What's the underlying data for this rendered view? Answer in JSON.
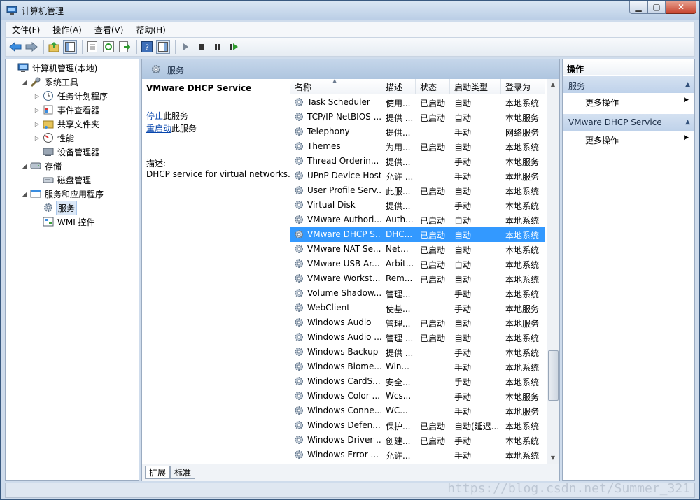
{
  "window": {
    "title": "计算机管理"
  },
  "menu": [
    "文件(F)",
    "操作(A)",
    "查看(V)",
    "帮助(H)"
  ],
  "tree": [
    {
      "label": "计算机管理(本地)",
      "indent": 0,
      "toggle": "",
      "icon": "computer-management-icon"
    },
    {
      "label": "系统工具",
      "indent": 1,
      "toggle": "◢",
      "icon": "tools-icon"
    },
    {
      "label": "任务计划程序",
      "indent": 2,
      "toggle": "▷",
      "icon": "clock-icon"
    },
    {
      "label": "事件查看器",
      "indent": 2,
      "toggle": "▷",
      "icon": "event-viewer-icon"
    },
    {
      "label": "共享文件夹",
      "indent": 2,
      "toggle": "▷",
      "icon": "shared-folder-icon"
    },
    {
      "label": "性能",
      "indent": 2,
      "toggle": "▷",
      "icon": "performance-icon"
    },
    {
      "label": "设备管理器",
      "indent": 2,
      "toggle": "",
      "icon": "device-manager-icon"
    },
    {
      "label": "存储",
      "indent": 1,
      "toggle": "◢",
      "icon": "storage-icon"
    },
    {
      "label": "磁盘管理",
      "indent": 2,
      "toggle": "",
      "icon": "disk-icon"
    },
    {
      "label": "服务和应用程序",
      "indent": 1,
      "toggle": "◢",
      "icon": "services-apps-icon"
    },
    {
      "label": "服务",
      "indent": 2,
      "toggle": "",
      "icon": "gear-icon",
      "selected": true
    },
    {
      "label": "WMI 控件",
      "indent": 2,
      "toggle": "",
      "icon": "wmi-icon"
    }
  ],
  "center": {
    "header": "服务",
    "service_title": "VMware DHCP Service",
    "stop_link": "停止",
    "stop_suffix": "此服务",
    "restart_link": "重启动",
    "restart_suffix": "此服务",
    "desc_label": "描述:",
    "desc_text": "DHCP service for virtual networks."
  },
  "columns": [
    "名称",
    "描述",
    "状态",
    "启动类型",
    "登录为"
  ],
  "services": [
    [
      "Task Scheduler",
      "使用...",
      "已启动",
      "自动",
      "本地系统"
    ],
    [
      "TCP/IP NetBIOS ...",
      "提供 ...",
      "已启动",
      "自动",
      "本地服务"
    ],
    [
      "Telephony",
      "提供...",
      "",
      "手动",
      "网络服务"
    ],
    [
      "Themes",
      "为用...",
      "已启动",
      "自动",
      "本地系统"
    ],
    [
      "Thread Orderin...",
      "提供...",
      "",
      "手动",
      "本地服务"
    ],
    [
      "UPnP Device Host",
      "允许 ...",
      "",
      "手动",
      "本地服务"
    ],
    [
      "User Profile Serv...",
      "此服...",
      "已启动",
      "自动",
      "本地系统"
    ],
    [
      "Virtual Disk",
      "提供...",
      "",
      "手动",
      "本地系统"
    ],
    [
      "VMware Authori...",
      "Auth...",
      "已启动",
      "自动",
      "本地系统"
    ],
    [
      "VMware DHCP S...",
      "DHC...",
      "已启动",
      "自动",
      "本地系统"
    ],
    [
      "VMware NAT Se...",
      "Net...",
      "已启动",
      "自动",
      "本地系统"
    ],
    [
      "VMware USB Ar...",
      "Arbit...",
      "已启动",
      "自动",
      "本地系统"
    ],
    [
      "VMware Workst...",
      "Rem...",
      "已启动",
      "自动",
      "本地系统"
    ],
    [
      "Volume Shadow...",
      "管理...",
      "",
      "手动",
      "本地系统"
    ],
    [
      "WebClient",
      "使基...",
      "",
      "手动",
      "本地服务"
    ],
    [
      "Windows Audio",
      "管理...",
      "已启动",
      "自动",
      "本地服务"
    ],
    [
      "Windows Audio ...",
      "管理 ...",
      "已启动",
      "自动",
      "本地系统"
    ],
    [
      "Windows Backup",
      "提供 ...",
      "",
      "手动",
      "本地系统"
    ],
    [
      "Windows Biome...",
      "Win...",
      "",
      "手动",
      "本地系统"
    ],
    [
      "Windows CardS...",
      "安全...",
      "",
      "手动",
      "本地系统"
    ],
    [
      "Windows Color ...",
      "Wcs...",
      "",
      "手动",
      "本地服务"
    ],
    [
      "Windows Conne...",
      "WC...",
      "",
      "手动",
      "本地服务"
    ],
    [
      "Windows Defen...",
      "保护...",
      "已启动",
      "自动(延迟...",
      "本地系统"
    ],
    [
      "Windows Driver ...",
      "创建...",
      "已启动",
      "手动",
      "本地系统"
    ],
    [
      "Windows Error ...",
      "允许...",
      "",
      "手动",
      "本地系统"
    ]
  ],
  "selected_service_index": 9,
  "tabs": [
    "扩展",
    "标准"
  ],
  "actions": {
    "title": "操作",
    "sections": [
      {
        "label": "服务",
        "item": "更多操作"
      },
      {
        "label": "VMware DHCP Service",
        "item": "更多操作"
      }
    ]
  },
  "watermark": "https://blog.csdn.net/Summer_321",
  "colors": {
    "selection": "#3399ff",
    "link": "#0645ad",
    "header": "#aec5df"
  }
}
